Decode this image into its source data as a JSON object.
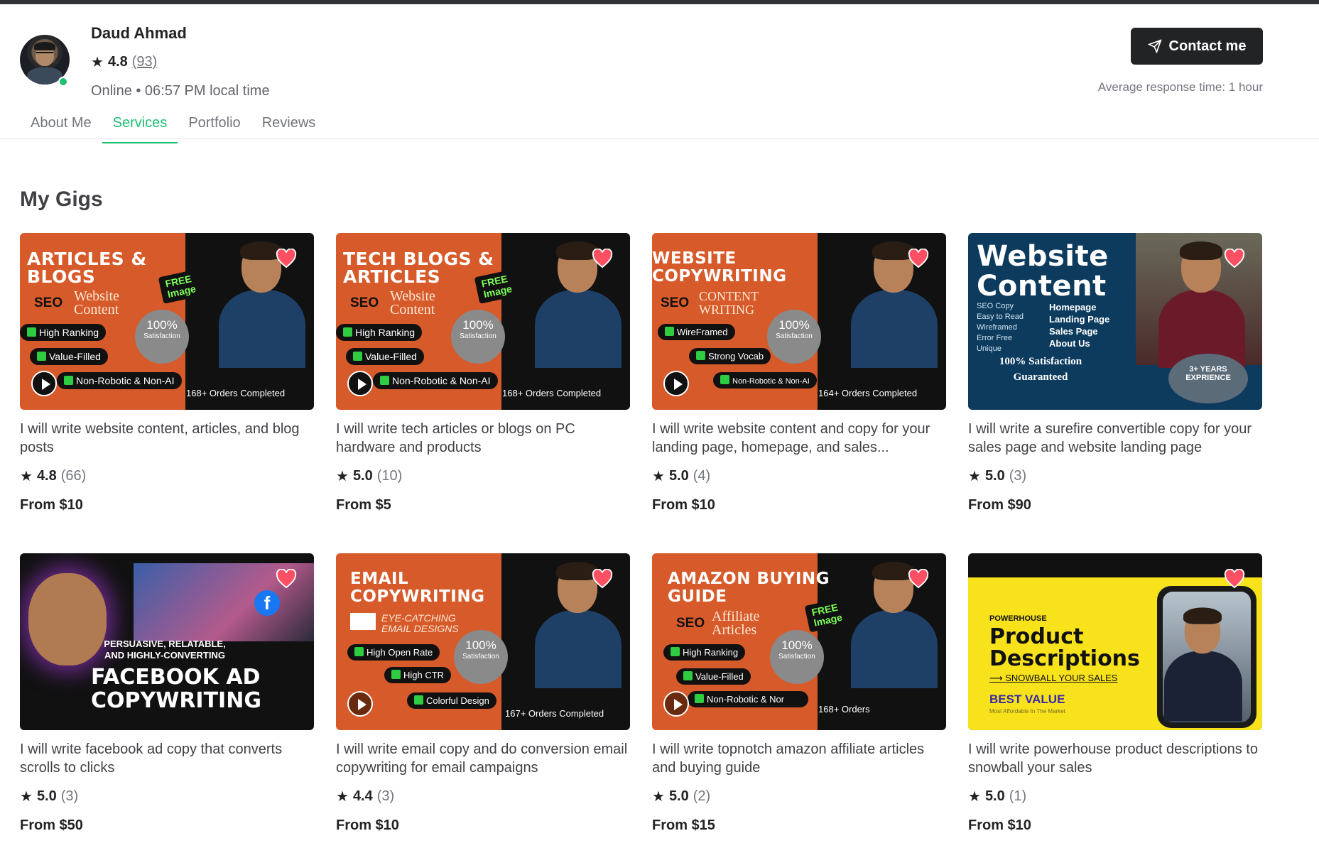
{
  "seller": {
    "name": "Daud Ahmad",
    "rating": "4.8",
    "rating_count": "(93)",
    "status": "Online • 06:57 PM local time",
    "contact_label": "Contact me",
    "response_time": "Average response time: 1 hour"
  },
  "tabs": [
    {
      "label": "About Me",
      "active": false
    },
    {
      "label": "Services",
      "active": true
    },
    {
      "label": "Portfolio",
      "active": false
    },
    {
      "label": "Reviews",
      "active": false
    }
  ],
  "section_title": "My Gigs",
  "colors": {
    "brand_green": "#1dbf73",
    "heart": "#ff4f63",
    "thumb_orange": "#d75a2a",
    "thumb_navy": "#0d3b5e",
    "thumb_yellow": "#f7e21b"
  },
  "gigs": [
    {
      "title": "I will write website content, articles, and blog posts",
      "rating": "4.8",
      "count": "(66)",
      "price": "From $10",
      "thumb": {
        "heading": "ARTICLES & BLOGS",
        "sub": "Website Content",
        "free": "FREE Image",
        "seo": "SEO",
        "pills": [
          "High Ranking",
          "Value-Filled",
          "Non-Robotic & Non-AI"
        ],
        "sat": "100%",
        "sat_sub": "Satisfaction",
        "orders": "168+ Orders Completed"
      }
    },
    {
      "title": "I will write tech articles or blogs on PC hardware and products",
      "rating": "5.0",
      "count": "(10)",
      "price": "From $5",
      "thumb": {
        "heading": "TECH BLOGS & ARTICLES",
        "sub": "Website Content",
        "free": "FREE Image",
        "seo": "SEO",
        "pills": [
          "High Ranking",
          "Value-Filled",
          "Non-Robotic & Non-AI"
        ],
        "sat": "100%",
        "sat_sub": "Satisfaction",
        "orders": "168+ Orders Completed"
      }
    },
    {
      "title": "I will write website content and copy for your landing page, homepage, and sales...",
      "rating": "5.0",
      "count": "(4)",
      "price": "From $10",
      "thumb": {
        "heading": "WEBSITE COPYWRITING",
        "sub": "CONTENT WRITING",
        "seo": "SEO",
        "pills": [
          "WireFramed",
          "Strong Vocab",
          "Non-Robotic & Non-AI"
        ],
        "sat": "100%",
        "sat_sub": "Satisfaction",
        "orders": "164+ Orders Completed"
      }
    },
    {
      "title": "I will write a surefire convertible copy for your sales page and website landing page",
      "rating": "5.0",
      "count": "(3)",
      "price": "From $90",
      "thumb": {
        "heading": "Website Content",
        "list_left": [
          "SEO Copy",
          "Easy to Read",
          "Wireframed",
          "Error Free",
          "Unique"
        ],
        "list_right": [
          "Homepage",
          "Landing Page",
          "Sales Page",
          "About Us"
        ],
        "guarantee": "100% Satisfaction Guaranteed",
        "badge": "3+ YEARS EXPRIENCE"
      }
    },
    {
      "title": "I will write facebook ad copy that converts scrolls to clicks",
      "rating": "5.0",
      "count": "(3)",
      "price": "From $50",
      "thumb": {
        "tagline": "PERSUASIVE, RELATABLE, AND HIGHLY-CONVERTING",
        "heading": "FACEBOOK AD COPYWRITING"
      }
    },
    {
      "title": "I will write email copy and do conversion email copywriting for email campaigns",
      "rating": "4.4",
      "count": "(3)",
      "price": "From $10",
      "thumb": {
        "heading": "EMAIL COPYWRITING",
        "sub": "EYE-CATCHING EMAIL DESIGNS",
        "pills": [
          "High Open Rate",
          "High CTR",
          "Colorful Design"
        ],
        "sat": "100%",
        "sat_sub": "Satisfaction",
        "orders": "167+ Orders Completed"
      }
    },
    {
      "title": "I will write topnotch amazon affiliate articles and buying guide",
      "rating": "5.0",
      "count": "(2)",
      "price": "From $15",
      "thumb": {
        "heading": "AMAZON BUYING GUIDE",
        "sub": "Affiliate Articles",
        "free": "FREE Image",
        "seo": "SEO",
        "pills": [
          "High Ranking",
          "Value-Filled",
          "Non-Robotic & Nor"
        ],
        "sat": "100%",
        "sat_sub": "Satisfaction",
        "orders": "168+ Orders"
      }
    },
    {
      "title": "I will write powerhouse product descriptions to snowball your sales",
      "rating": "5.0",
      "count": "(1)",
      "price": "From $10",
      "thumb": {
        "small": "POWERHOUSE",
        "heading": "Product Descriptions",
        "arrow": "SNOWBALL YOUR SALES",
        "value": "BEST VALUE",
        "value_sub": "Most Affordable In The Market"
      }
    }
  ]
}
